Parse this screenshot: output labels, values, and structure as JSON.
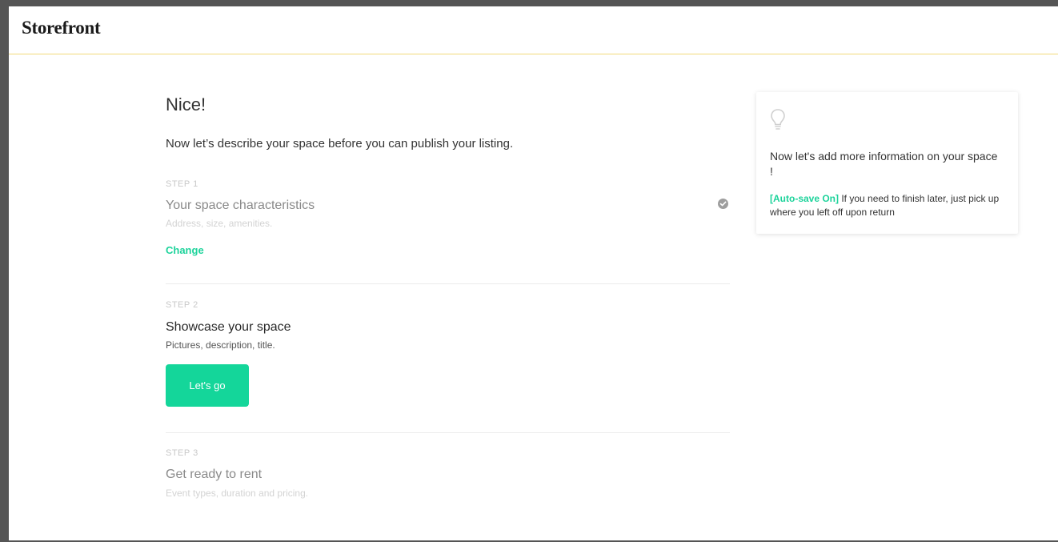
{
  "header": {
    "logo": "Storefront"
  },
  "main": {
    "heading": "Nice!",
    "intro": "Now let’s describe your space before you can publish your listing.",
    "steps": [
      {
        "label": "STEP 1",
        "title": "Your space characteristics",
        "subtitle": "Address, size, amenities.",
        "status": "completed",
        "action": "Change"
      },
      {
        "label": "STEP 2",
        "title": "Showcase your space",
        "subtitle": "Pictures, description, title.",
        "status": "active",
        "action": "Let's go"
      },
      {
        "label": "STEP 3",
        "title": "Get ready to rent",
        "subtitle": "Event types, duration and pricing.",
        "status": "locked"
      }
    ]
  },
  "tip": {
    "icon": "lightbulb-icon",
    "message": "Now let's add more information on your space !",
    "autosave_label": "[Auto-save On]",
    "autosave_text": " If you need to finish later, just pick up where you left off upon return"
  },
  "colors": {
    "accent": "#14d69a",
    "header_border": "#f2d97a",
    "frame": "#555555"
  }
}
